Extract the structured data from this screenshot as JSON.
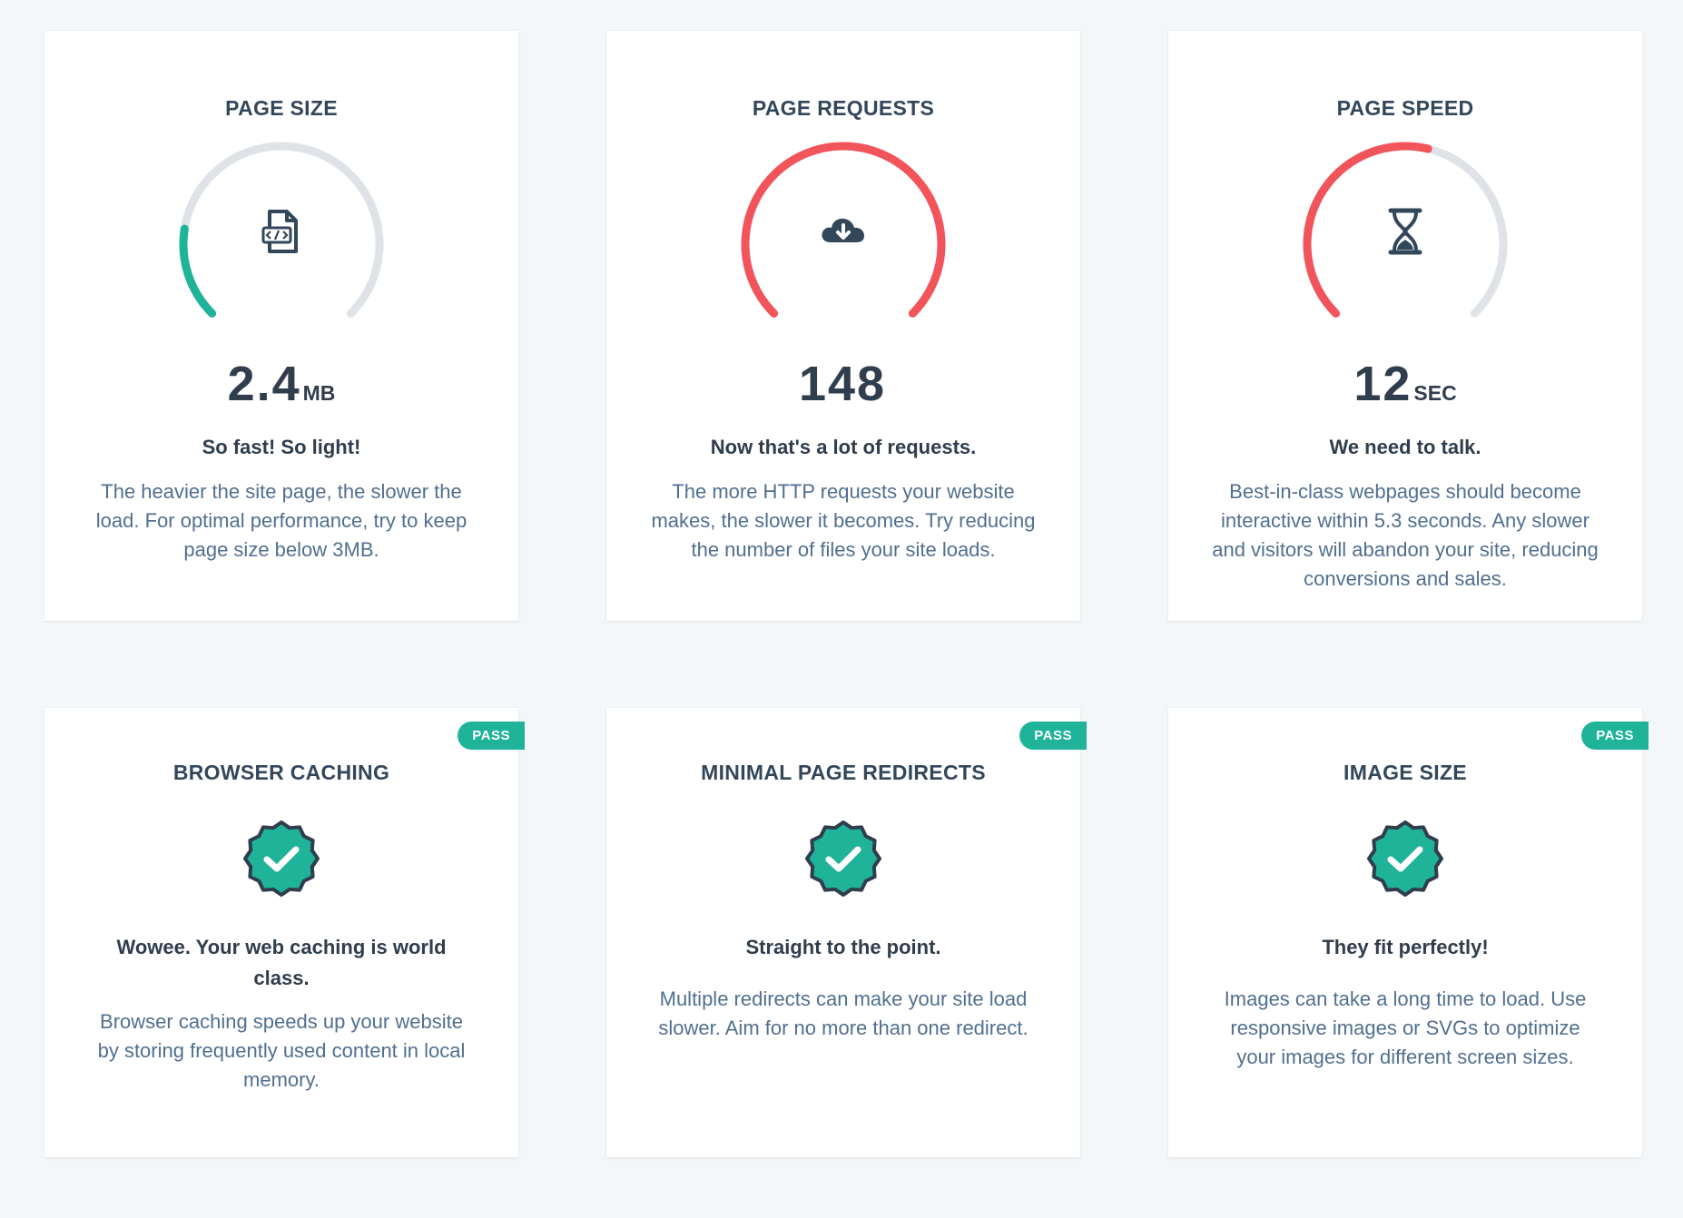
{
  "metrics": [
    {
      "title": "PAGE SIZE",
      "value": "2.4",
      "unit": "MB",
      "tagline": "So fast! So light!",
      "description": "The heavier the site page, the slower the load. For optimal performance, try to keep page size below 3MB.",
      "icon": "code-file-icon",
      "gauge_fill": 0.2,
      "gauge_color": "#1fb39a"
    },
    {
      "title": "PAGE REQUESTS",
      "value": "148",
      "unit": "",
      "tagline": "Now that's a lot of requests.",
      "description": "The more HTTP requests your website makes, the slower it becomes. Try reducing the number of files your site loads.",
      "icon": "cloud-download-icon",
      "gauge_fill": 1.0,
      "gauge_color": "#f2545b"
    },
    {
      "title": "PAGE SPEED",
      "value": "12",
      "unit": "SEC",
      "tagline": "We need to talk.",
      "description": "Best-in-class webpages should become interactive within 5.3 seconds. Any slower and visitors will abandon your site, reducing conversions and sales.",
      "icon": "hourglass-icon",
      "gauge_fill": 0.55,
      "gauge_color": "#f2545b"
    }
  ],
  "checks": [
    {
      "title": "BROWSER CACHING",
      "badge": "PASS",
      "tagline": "Wowee. Your web caching is world class.",
      "description": "Browser caching speeds up your website by storing frequently used content in local memory.",
      "icon": "check-badge-icon"
    },
    {
      "title": "MINIMAL PAGE REDIRECTS",
      "badge": "PASS",
      "tagline": "Straight to the point.",
      "description": "Multiple redirects can make your site load slower. Aim for no more than one redirect.",
      "icon": "check-badge-icon"
    },
    {
      "title": "IMAGE SIZE",
      "badge": "PASS",
      "tagline": "They fit perfectly!",
      "description": "Images can take a long time to load. Use responsive images or SVGs to optimize your images for different screen sizes.",
      "icon": "check-badge-icon"
    }
  ],
  "colors": {
    "background": "#f4f7f9",
    "card": "#ffffff",
    "text": "#33475b",
    "muted_text": "#516f90",
    "pass": "#1fb39a",
    "fail": "#f2545b",
    "gauge_track": "#dfe3e8"
  }
}
